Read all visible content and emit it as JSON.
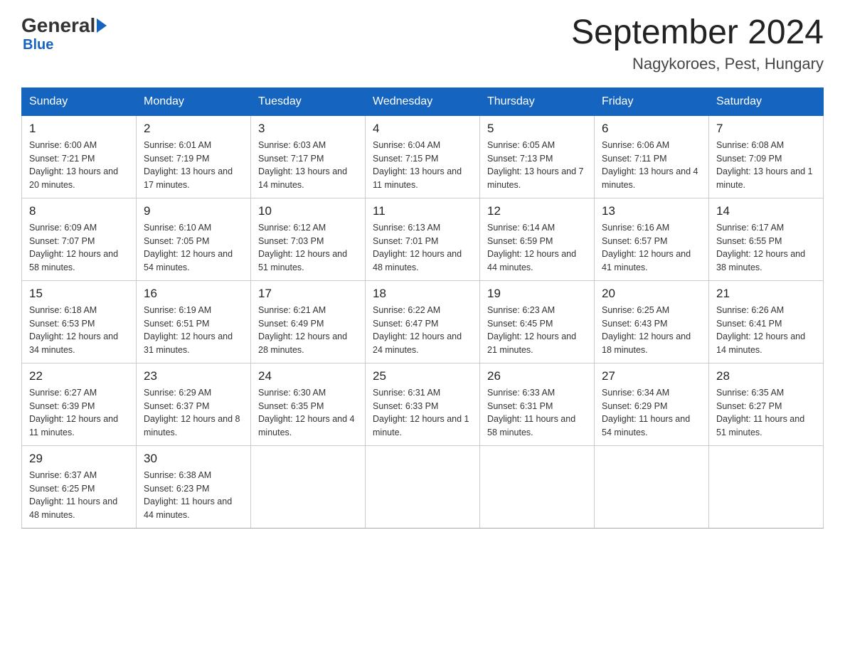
{
  "header": {
    "logo_general": "General",
    "logo_blue": "Blue",
    "month_title": "September 2024",
    "location": "Nagykoroes, Pest, Hungary"
  },
  "weekdays": [
    "Sunday",
    "Monday",
    "Tuesday",
    "Wednesday",
    "Thursday",
    "Friday",
    "Saturday"
  ],
  "weeks": [
    [
      {
        "day": "1",
        "sunrise": "6:00 AM",
        "sunset": "7:21 PM",
        "daylight": "13 hours and 20 minutes."
      },
      {
        "day": "2",
        "sunrise": "6:01 AM",
        "sunset": "7:19 PM",
        "daylight": "13 hours and 17 minutes."
      },
      {
        "day": "3",
        "sunrise": "6:03 AM",
        "sunset": "7:17 PM",
        "daylight": "13 hours and 14 minutes."
      },
      {
        "day": "4",
        "sunrise": "6:04 AM",
        "sunset": "7:15 PM",
        "daylight": "13 hours and 11 minutes."
      },
      {
        "day": "5",
        "sunrise": "6:05 AM",
        "sunset": "7:13 PM",
        "daylight": "13 hours and 7 minutes."
      },
      {
        "day": "6",
        "sunrise": "6:06 AM",
        "sunset": "7:11 PM",
        "daylight": "13 hours and 4 minutes."
      },
      {
        "day": "7",
        "sunrise": "6:08 AM",
        "sunset": "7:09 PM",
        "daylight": "13 hours and 1 minute."
      }
    ],
    [
      {
        "day": "8",
        "sunrise": "6:09 AM",
        "sunset": "7:07 PM",
        "daylight": "12 hours and 58 minutes."
      },
      {
        "day": "9",
        "sunrise": "6:10 AM",
        "sunset": "7:05 PM",
        "daylight": "12 hours and 54 minutes."
      },
      {
        "day": "10",
        "sunrise": "6:12 AM",
        "sunset": "7:03 PM",
        "daylight": "12 hours and 51 minutes."
      },
      {
        "day": "11",
        "sunrise": "6:13 AM",
        "sunset": "7:01 PM",
        "daylight": "12 hours and 48 minutes."
      },
      {
        "day": "12",
        "sunrise": "6:14 AM",
        "sunset": "6:59 PM",
        "daylight": "12 hours and 44 minutes."
      },
      {
        "day": "13",
        "sunrise": "6:16 AM",
        "sunset": "6:57 PM",
        "daylight": "12 hours and 41 minutes."
      },
      {
        "day": "14",
        "sunrise": "6:17 AM",
        "sunset": "6:55 PM",
        "daylight": "12 hours and 38 minutes."
      }
    ],
    [
      {
        "day": "15",
        "sunrise": "6:18 AM",
        "sunset": "6:53 PM",
        "daylight": "12 hours and 34 minutes."
      },
      {
        "day": "16",
        "sunrise": "6:19 AM",
        "sunset": "6:51 PM",
        "daylight": "12 hours and 31 minutes."
      },
      {
        "day": "17",
        "sunrise": "6:21 AM",
        "sunset": "6:49 PM",
        "daylight": "12 hours and 28 minutes."
      },
      {
        "day": "18",
        "sunrise": "6:22 AM",
        "sunset": "6:47 PM",
        "daylight": "12 hours and 24 minutes."
      },
      {
        "day": "19",
        "sunrise": "6:23 AM",
        "sunset": "6:45 PM",
        "daylight": "12 hours and 21 minutes."
      },
      {
        "day": "20",
        "sunrise": "6:25 AM",
        "sunset": "6:43 PM",
        "daylight": "12 hours and 18 minutes."
      },
      {
        "day": "21",
        "sunrise": "6:26 AM",
        "sunset": "6:41 PM",
        "daylight": "12 hours and 14 minutes."
      }
    ],
    [
      {
        "day": "22",
        "sunrise": "6:27 AM",
        "sunset": "6:39 PM",
        "daylight": "12 hours and 11 minutes."
      },
      {
        "day": "23",
        "sunrise": "6:29 AM",
        "sunset": "6:37 PM",
        "daylight": "12 hours and 8 minutes."
      },
      {
        "day": "24",
        "sunrise": "6:30 AM",
        "sunset": "6:35 PM",
        "daylight": "12 hours and 4 minutes."
      },
      {
        "day": "25",
        "sunrise": "6:31 AM",
        "sunset": "6:33 PM",
        "daylight": "12 hours and 1 minute."
      },
      {
        "day": "26",
        "sunrise": "6:33 AM",
        "sunset": "6:31 PM",
        "daylight": "11 hours and 58 minutes."
      },
      {
        "day": "27",
        "sunrise": "6:34 AM",
        "sunset": "6:29 PM",
        "daylight": "11 hours and 54 minutes."
      },
      {
        "day": "28",
        "sunrise": "6:35 AM",
        "sunset": "6:27 PM",
        "daylight": "11 hours and 51 minutes."
      }
    ],
    [
      {
        "day": "29",
        "sunrise": "6:37 AM",
        "sunset": "6:25 PM",
        "daylight": "11 hours and 48 minutes."
      },
      {
        "day": "30",
        "sunrise": "6:38 AM",
        "sunset": "6:23 PM",
        "daylight": "11 hours and 44 minutes."
      },
      null,
      null,
      null,
      null,
      null
    ]
  ]
}
